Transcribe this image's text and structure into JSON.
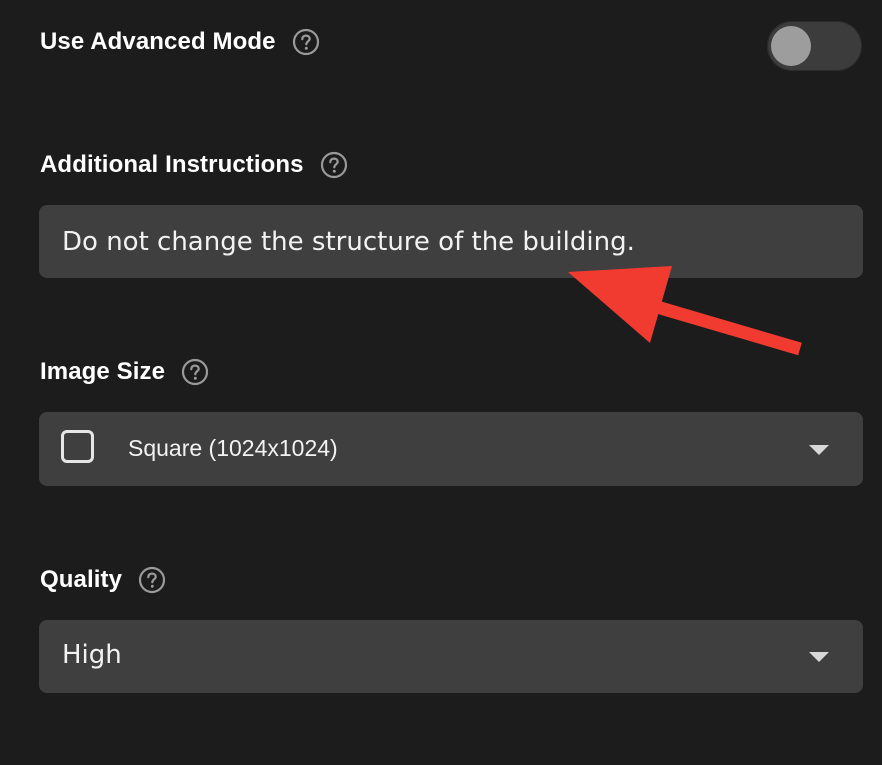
{
  "advanced_mode": {
    "label": "Use Advanced Mode",
    "help_icon": "help-circle-icon",
    "toggle_on": false
  },
  "additional_instructions": {
    "label": "Additional Instructions",
    "help_icon": "help-circle-icon",
    "value": "Do not change the structure of the building."
  },
  "image_size": {
    "label": "Image Size",
    "help_icon": "help-circle-icon",
    "selected": "Square (1024x1024)",
    "option_icon": "square-icon",
    "dropdown_icon": "caret-down-icon"
  },
  "quality": {
    "label": "Quality",
    "help_icon": "help-circle-icon",
    "selected": "High",
    "dropdown_icon": "caret-down-icon"
  },
  "colors": {
    "background": "#1c1c1c",
    "field": "#3f3f3f",
    "annotation_arrow": "#f23b30"
  }
}
